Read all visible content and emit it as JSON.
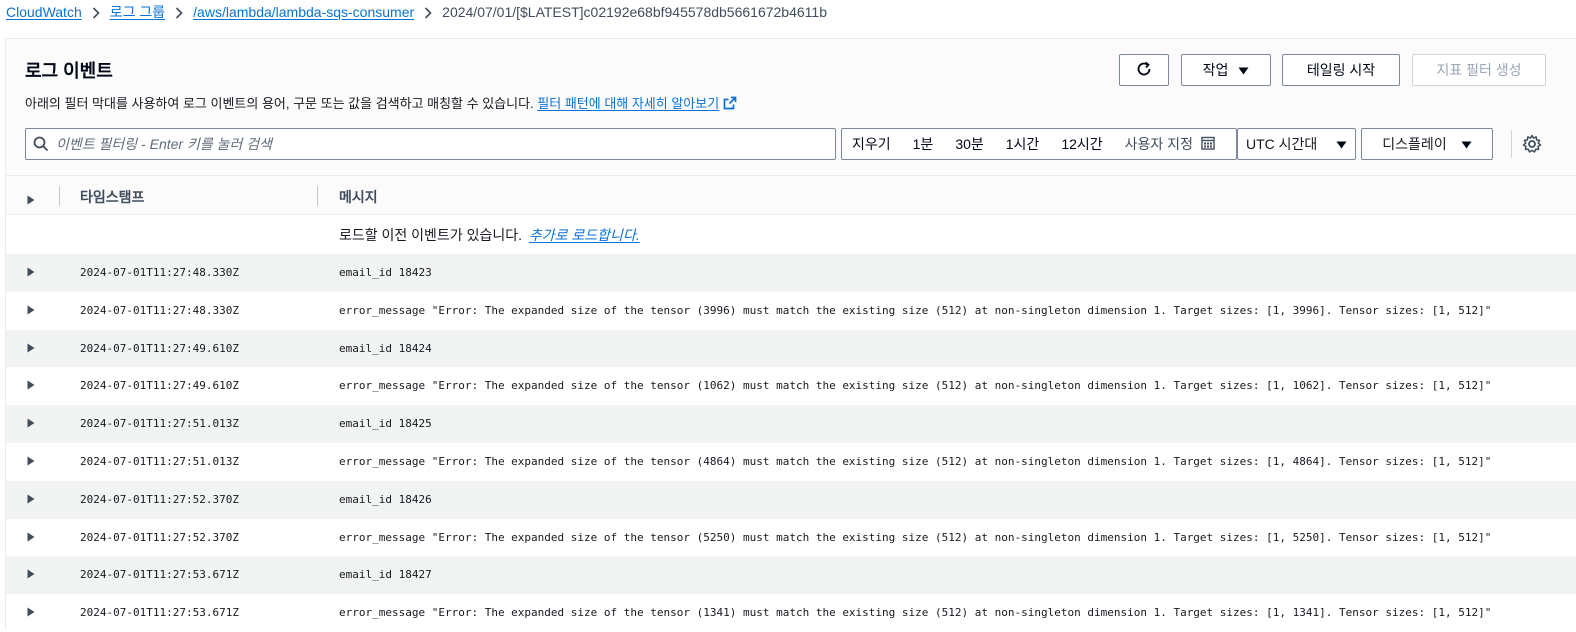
{
  "breadcrumb": {
    "items": [
      "CloudWatch",
      "로그 그룹",
      "/aws/lambda/lambda-sqs-consumer"
    ],
    "current": "2024/07/01/[$LATEST]c02192e68bf945578db5661672b4611b"
  },
  "header": {
    "title": "로그 이벤트",
    "description": "아래의 필터 막대를 사용하여 로그 이벤트의 용어, 구문 또는 값을 검색하고 매칭할 수 있습니다.",
    "learn_more": "필터 패턴에 대해 자세히 알아보기",
    "actions_label": "작업",
    "tailing_label": "테일링 시작",
    "create_metric_filter_label": "지표 필터 생성"
  },
  "filter": {
    "placeholder": "이벤트 필터링 - Enter 키를 눌러 검색"
  },
  "time_range": {
    "clear": "지우기",
    "options": [
      "1분",
      "30분",
      "1시간",
      "12시간"
    ],
    "custom": "사용자 지정"
  },
  "timezone": "UTC 시간대",
  "display_label": "디스플레이",
  "table": {
    "col_timestamp": "타임스탬프",
    "col_message": "메시지",
    "load_text": "로드할 이전 이벤트가 있습니다.",
    "load_more": "추가로 로드합니다.",
    "rows": [
      {
        "ts": "2024-07-01T11:27:48.330Z",
        "msg": "email_id 18423"
      },
      {
        "ts": "2024-07-01T11:27:48.330Z",
        "msg": "error_message \"Error: The expanded size of the tensor (3996) must match the existing size (512) at non-singleton dimension 1. Target sizes: [1, 3996]. Tensor sizes: [1, 512]\""
      },
      {
        "ts": "2024-07-01T11:27:49.610Z",
        "msg": "email_id 18424"
      },
      {
        "ts": "2024-07-01T11:27:49.610Z",
        "msg": "error_message \"Error: The expanded size of the tensor (1062) must match the existing size (512) at non-singleton dimension 1. Target sizes: [1, 1062]. Tensor sizes: [1, 512]\""
      },
      {
        "ts": "2024-07-01T11:27:51.013Z",
        "msg": "email_id 18425"
      },
      {
        "ts": "2024-07-01T11:27:51.013Z",
        "msg": "error_message \"Error: The expanded size of the tensor (4864) must match the existing size (512) at non-singleton dimension 1. Target sizes: [1, 4864]. Tensor sizes: [1, 512]\""
      },
      {
        "ts": "2024-07-01T11:27:52.370Z",
        "msg": "email_id 18426"
      },
      {
        "ts": "2024-07-01T11:27:52.370Z",
        "msg": "error_message \"Error: The expanded size of the tensor (5250) must match the existing size (512) at non-singleton dimension 1. Target sizes: [1, 5250]. Tensor sizes: [1, 512]\""
      },
      {
        "ts": "2024-07-01T11:27:53.671Z",
        "msg": "email_id 18427"
      },
      {
        "ts": "2024-07-01T11:27:53.671Z",
        "msg": "error_message \"Error: The expanded size of the tensor (1341) must match the existing size (512) at non-singleton dimension 1. Target sizes: [1, 1341]. Tensor sizes: [1, 512]\""
      }
    ]
  }
}
